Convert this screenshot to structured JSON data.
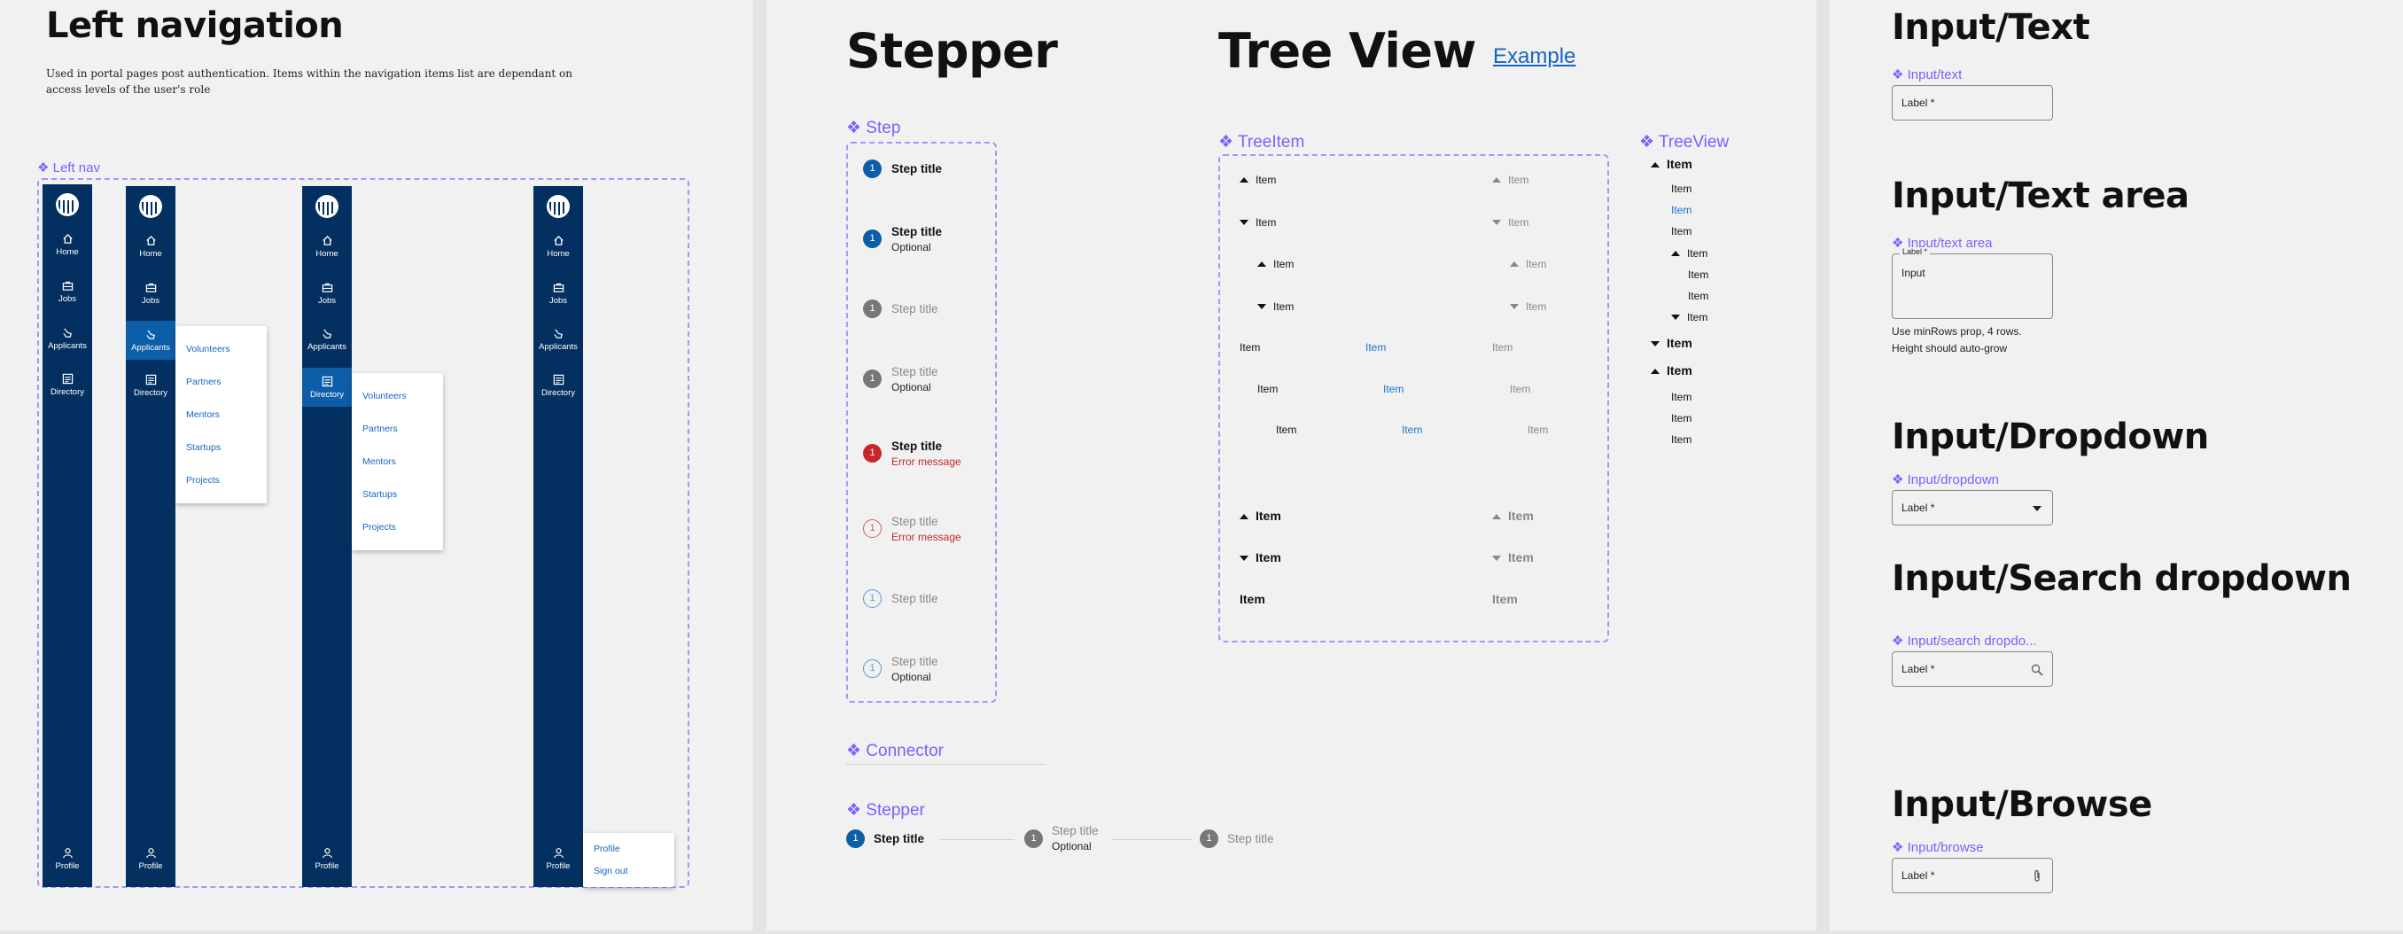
{
  "left_nav": {
    "title": "Left navigation",
    "description": "Used in portal pages post authentication. Items within the navigation items list are dependant on access levels of the user's role",
    "component_label": "❖ Left nav",
    "items": [
      "Home",
      "Jobs",
      "Applicants",
      "Directory"
    ],
    "profile": "Profile",
    "flyout_items": [
      "Volunteers",
      "Partners",
      "Mentors",
      "Startups",
      "Projects"
    ],
    "profile_menu": [
      "Profile",
      "Sign out"
    ],
    "colors": {
      "nav_bg": "#043061",
      "active_bg": "#0d5ea8",
      "accent": "#7b61ff"
    }
  },
  "stepper": {
    "title": "Stepper",
    "step_label": "❖ Step",
    "connector_label": "❖ Connector",
    "stepper_label": "❖ Stepper",
    "num": "1",
    "step_title": "Step title",
    "optional": "Optional",
    "error": "Error message"
  },
  "tree": {
    "title": "Tree View",
    "example_link": "Example",
    "treeitem_label": "❖ TreeItem",
    "treeview_label": "❖ TreeView",
    "item": "Item"
  },
  "inputs": {
    "text_title": "Input/Text",
    "text_label": "❖ Input/text",
    "textarea_title": "Input/Text area",
    "textarea_label": "❖ Input/text area",
    "dropdown_title": "Input/Dropdown",
    "dropdown_label": "❖ Input/dropdown",
    "search_title": "Input/Search dropdown",
    "search_label": "❖ Input/search dropdo...",
    "browse_title": "Input/Browse",
    "browse_label": "❖ Input/browse",
    "field_label": "Label *",
    "area_label": "Label *",
    "area_value": "Input",
    "note_line1": "Use minRows prop, 4 rows.",
    "note_line2": "Height should auto-grow"
  }
}
